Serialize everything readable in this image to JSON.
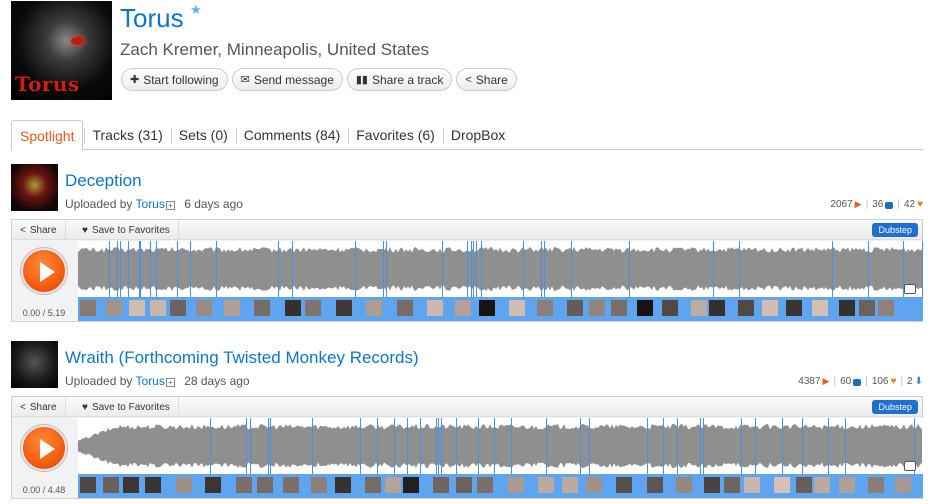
{
  "profile": {
    "name": "Torus",
    "location": "Zach Kremer, Minneapolis, United States",
    "avatar_logo_text": "Torus",
    "actions": {
      "follow": "Start following",
      "message": "Send message",
      "share_track": "Share a track",
      "share": "Share"
    }
  },
  "tabs": [
    {
      "label": "Spotlight",
      "active": true
    },
    {
      "label": "Tracks (31)"
    },
    {
      "label": "Sets (0)"
    },
    {
      "label": "Comments (84)"
    },
    {
      "label": "Favorites (6)"
    },
    {
      "label": "DropBox"
    }
  ],
  "tracks": [
    {
      "title": "Deception",
      "uploaded_by_label": "Uploaded by",
      "user": "Torus",
      "ago": "6 days ago",
      "plays": "2067",
      "comments": "36",
      "favorites": "42",
      "share_label": "Share",
      "favorite_label": "Save to Favorites",
      "genre": "Dubstep",
      "time": "0.00 / 5.19"
    },
    {
      "title": "Wraith (Forthcoming Twisted Monkey Records)",
      "uploaded_by_label": "Uploaded by",
      "user": "Torus",
      "ago": "28 days ago",
      "plays": "4387",
      "comments": "60",
      "favorites": "106",
      "downloads": "2",
      "share_label": "Share",
      "favorite_label": "Save to Favorites",
      "genre": "Dubstep",
      "time": "0.00 / 4.48"
    }
  ],
  "colors": {
    "link": "#0e76c8",
    "accent": "#f05a13",
    "genre": "#1f6fd0"
  }
}
